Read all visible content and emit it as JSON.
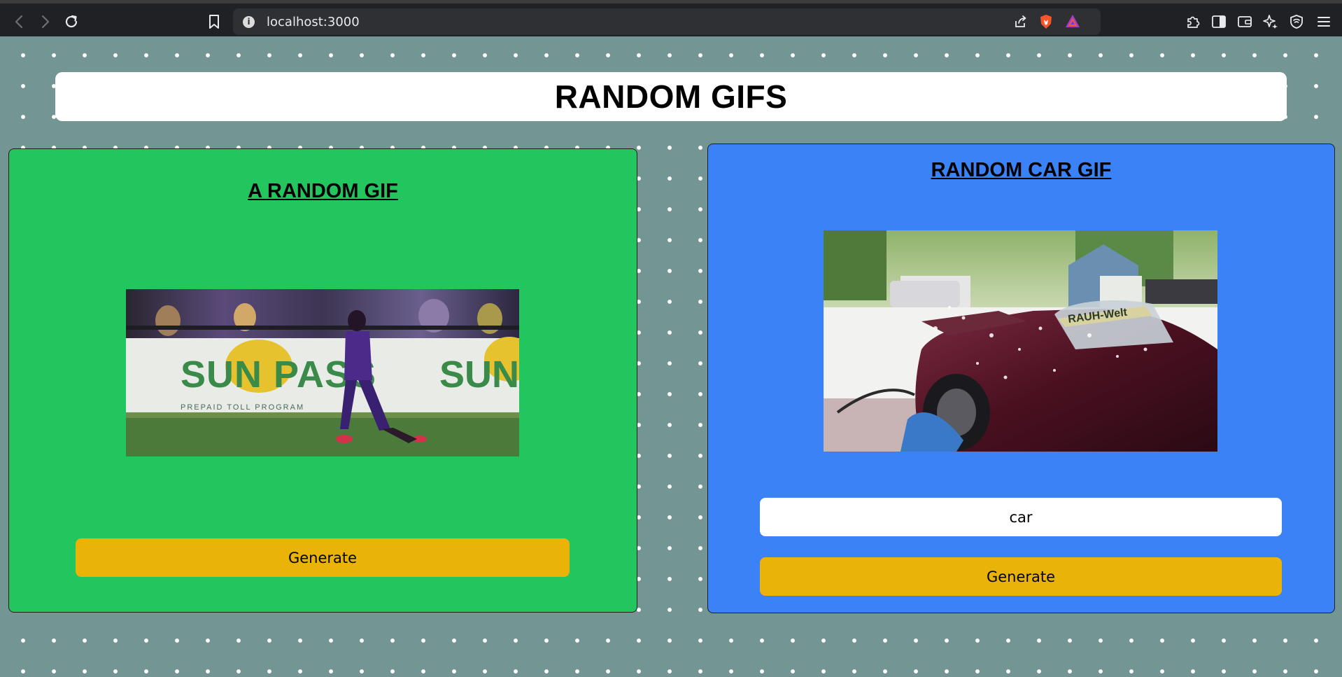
{
  "browser": {
    "url": "localhost:3000",
    "icons": [
      "back-icon",
      "forward-icon",
      "reload-icon",
      "bookmark-icon",
      "site-info-icon",
      "share-icon",
      "brave-shields-icon",
      "brave-rewards-icon",
      "extensions-icon",
      "sidebar-icon",
      "wallet-icon",
      "leo-ai-icon",
      "vpn-icon",
      "menu-icon"
    ]
  },
  "page": {
    "title": "RANDOM GIFS"
  },
  "random_card": {
    "title": "A RANDOM GIF",
    "image": "soccer-player-gif",
    "button_label": "Generate"
  },
  "car_card": {
    "title": "RANDOM CAR GIF",
    "image": "car-wash-gif",
    "tag_value": "car",
    "button_label": "Generate"
  },
  "colors": {
    "background": "#739694",
    "random_card": "#22c55e",
    "car_card": "#3b82f6",
    "button": "#eab308"
  }
}
